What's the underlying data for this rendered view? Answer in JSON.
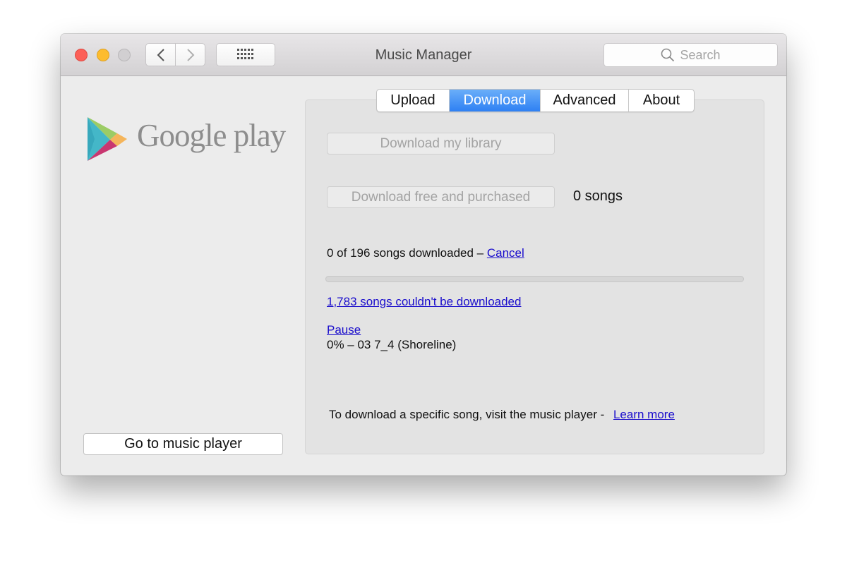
{
  "window": {
    "title": "Music Manager"
  },
  "toolbar": {
    "search_placeholder": "Search"
  },
  "sidebar": {
    "logo_text": "Google play",
    "go_button": "Go to music player"
  },
  "tabs": [
    {
      "label": "Upload",
      "active": false
    },
    {
      "label": "Download",
      "active": true
    },
    {
      "label": "Advanced",
      "active": false
    },
    {
      "label": "About",
      "active": false
    }
  ],
  "download": {
    "download_library_button": "Download my library",
    "download_free_button": "Download free and purchased",
    "song_count": "0 songs",
    "status_text": "0 of 196 songs downloaded – ",
    "cancel_link": "Cancel",
    "progress_fraction": 0,
    "failed_link": "1,783 songs couldn't be downloaded",
    "pause_link": "Pause",
    "current_item": "0% – 03 7_4 (Shoreline)",
    "hint_text": "To download a specific song, visit the music player - ",
    "learn_more_link": "Learn more"
  },
  "colors": {
    "accent": "#2e80f3",
    "link": "#1a0dcc",
    "close": "#fc5f57",
    "minimize": "#fdbc2e",
    "zoom_inactive": "#d1cfd1"
  },
  "icons": [
    "close-button",
    "minimize-button",
    "zoom-button",
    "back-chevron-icon",
    "forward-chevron-icon",
    "grid-icon",
    "search-icon",
    "google-play-logo-icon"
  ]
}
